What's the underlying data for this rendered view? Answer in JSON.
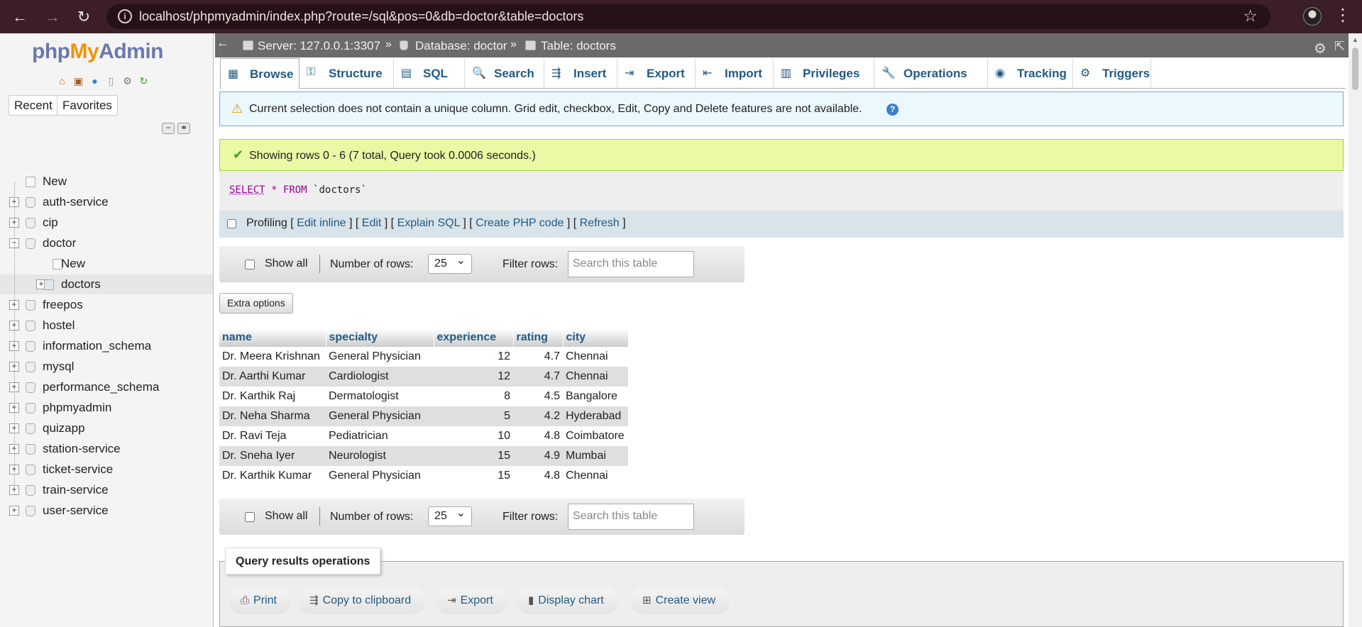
{
  "browser": {
    "url": "localhost/phpmyadmin/index.php?route=/sql&pos=0&db=doctor&table=doctors"
  },
  "sidebar": {
    "logo": {
      "php": "php",
      "my": "My",
      "admin": "Admin"
    },
    "recent_label": "Recent",
    "favorites_label": "Favorites",
    "tree": [
      {
        "label": "New",
        "level": 0,
        "kind": "new"
      },
      {
        "label": "auth-service",
        "level": 0,
        "kind": "db"
      },
      {
        "label": "cip",
        "level": 0,
        "kind": "db"
      },
      {
        "label": "doctor",
        "level": 0,
        "kind": "db-open"
      },
      {
        "label": "New",
        "level": 1,
        "kind": "new"
      },
      {
        "label": "doctors",
        "level": 1,
        "kind": "table",
        "selected": true
      },
      {
        "label": "freepos",
        "level": 0,
        "kind": "db"
      },
      {
        "label": "hostel",
        "level": 0,
        "kind": "db"
      },
      {
        "label": "information_schema",
        "level": 0,
        "kind": "db"
      },
      {
        "label": "mysql",
        "level": 0,
        "kind": "db"
      },
      {
        "label": "performance_schema",
        "level": 0,
        "kind": "db"
      },
      {
        "label": "phpmyadmin",
        "level": 0,
        "kind": "db"
      },
      {
        "label": "quizapp",
        "level": 0,
        "kind": "db"
      },
      {
        "label": "station-service",
        "level": 0,
        "kind": "db"
      },
      {
        "label": "ticket-service",
        "level": 0,
        "kind": "db"
      },
      {
        "label": "train-service",
        "level": 0,
        "kind": "db"
      },
      {
        "label": "user-service",
        "level": 0,
        "kind": "db"
      }
    ]
  },
  "breadcrumb": {
    "server": "Server: 127.0.0.1:3307",
    "database": "Database: doctor",
    "table": "Table: doctors",
    "sep": "»"
  },
  "tabs": [
    {
      "label": "Browse",
      "icon": "▦"
    },
    {
      "label": "Structure",
      "icon": "⚿"
    },
    {
      "label": "SQL",
      "icon": "▤"
    },
    {
      "label": "Search",
      "icon": "🔍"
    },
    {
      "label": "Insert",
      "icon": "⇶"
    },
    {
      "label": "Export",
      "icon": "⇥"
    },
    {
      "label": "Import",
      "icon": "⇤"
    },
    {
      "label": "Privileges",
      "icon": "▥"
    },
    {
      "label": "Operations",
      "icon": "🔧"
    },
    {
      "label": "Tracking",
      "icon": "◉"
    },
    {
      "label": "Triggers",
      "icon": "⚙"
    }
  ],
  "notice": {
    "text": "Current selection does not contain a unique column. Grid edit, checkbox, Edit, Copy and Delete features are not available.",
    "help": "?"
  },
  "success": {
    "text": "Showing rows 0 - 6 (7 total, Query took 0.0006 seconds.)"
  },
  "query": {
    "select": "SELECT",
    "star": "*",
    "from": "FROM",
    "table": "`doctors`"
  },
  "profiling": {
    "label": "Profiling",
    "links": [
      "Edit inline",
      "Edit",
      "Explain SQL",
      "Create PHP code",
      "Refresh"
    ]
  },
  "navigation": {
    "show_all": "Show all",
    "number_of_rows_label": "Number of rows:",
    "rows_value": "25",
    "filter_label": "Filter rows:",
    "filter_placeholder": "Search this table"
  },
  "extra_options": "Extra options",
  "table": {
    "columns": [
      "name",
      "specialty",
      "experience",
      "rating",
      "city"
    ],
    "rows": [
      [
        "Dr. Meera Krishnan",
        "General Physician",
        "12",
        "4.7",
        "Chennai"
      ],
      [
        "Dr. Aarthi Kumar",
        "Cardiologist",
        "12",
        "4.7",
        "Chennai"
      ],
      [
        "Dr. Karthik Raj",
        "Dermatologist",
        "8",
        "4.5",
        "Bangalore"
      ],
      [
        "Dr. Neha Sharma",
        "General Physician",
        "5",
        "4.2",
        "Hyderabad"
      ],
      [
        "Dr. Ravi Teja",
        "Pediatrician",
        "10",
        "4.8",
        "Coimbatore"
      ],
      [
        "Dr. Sneha Iyer",
        "Neurologist",
        "15",
        "4.9",
        "Mumbai"
      ],
      [
        "Dr. Karthik Kumar",
        "General Physician",
        "15",
        "4.8",
        "Chennai"
      ]
    ]
  },
  "query_results_operations": {
    "title": "Query results operations",
    "buttons": [
      {
        "label": "Print",
        "icon": "print-icon"
      },
      {
        "label": "Copy to clipboard",
        "icon": "clipboard-icon"
      },
      {
        "label": "Export",
        "icon": "export-icon"
      },
      {
        "label": "Display chart",
        "icon": "chart-icon"
      },
      {
        "label": "Create view",
        "icon": "view-icon"
      }
    ]
  }
}
